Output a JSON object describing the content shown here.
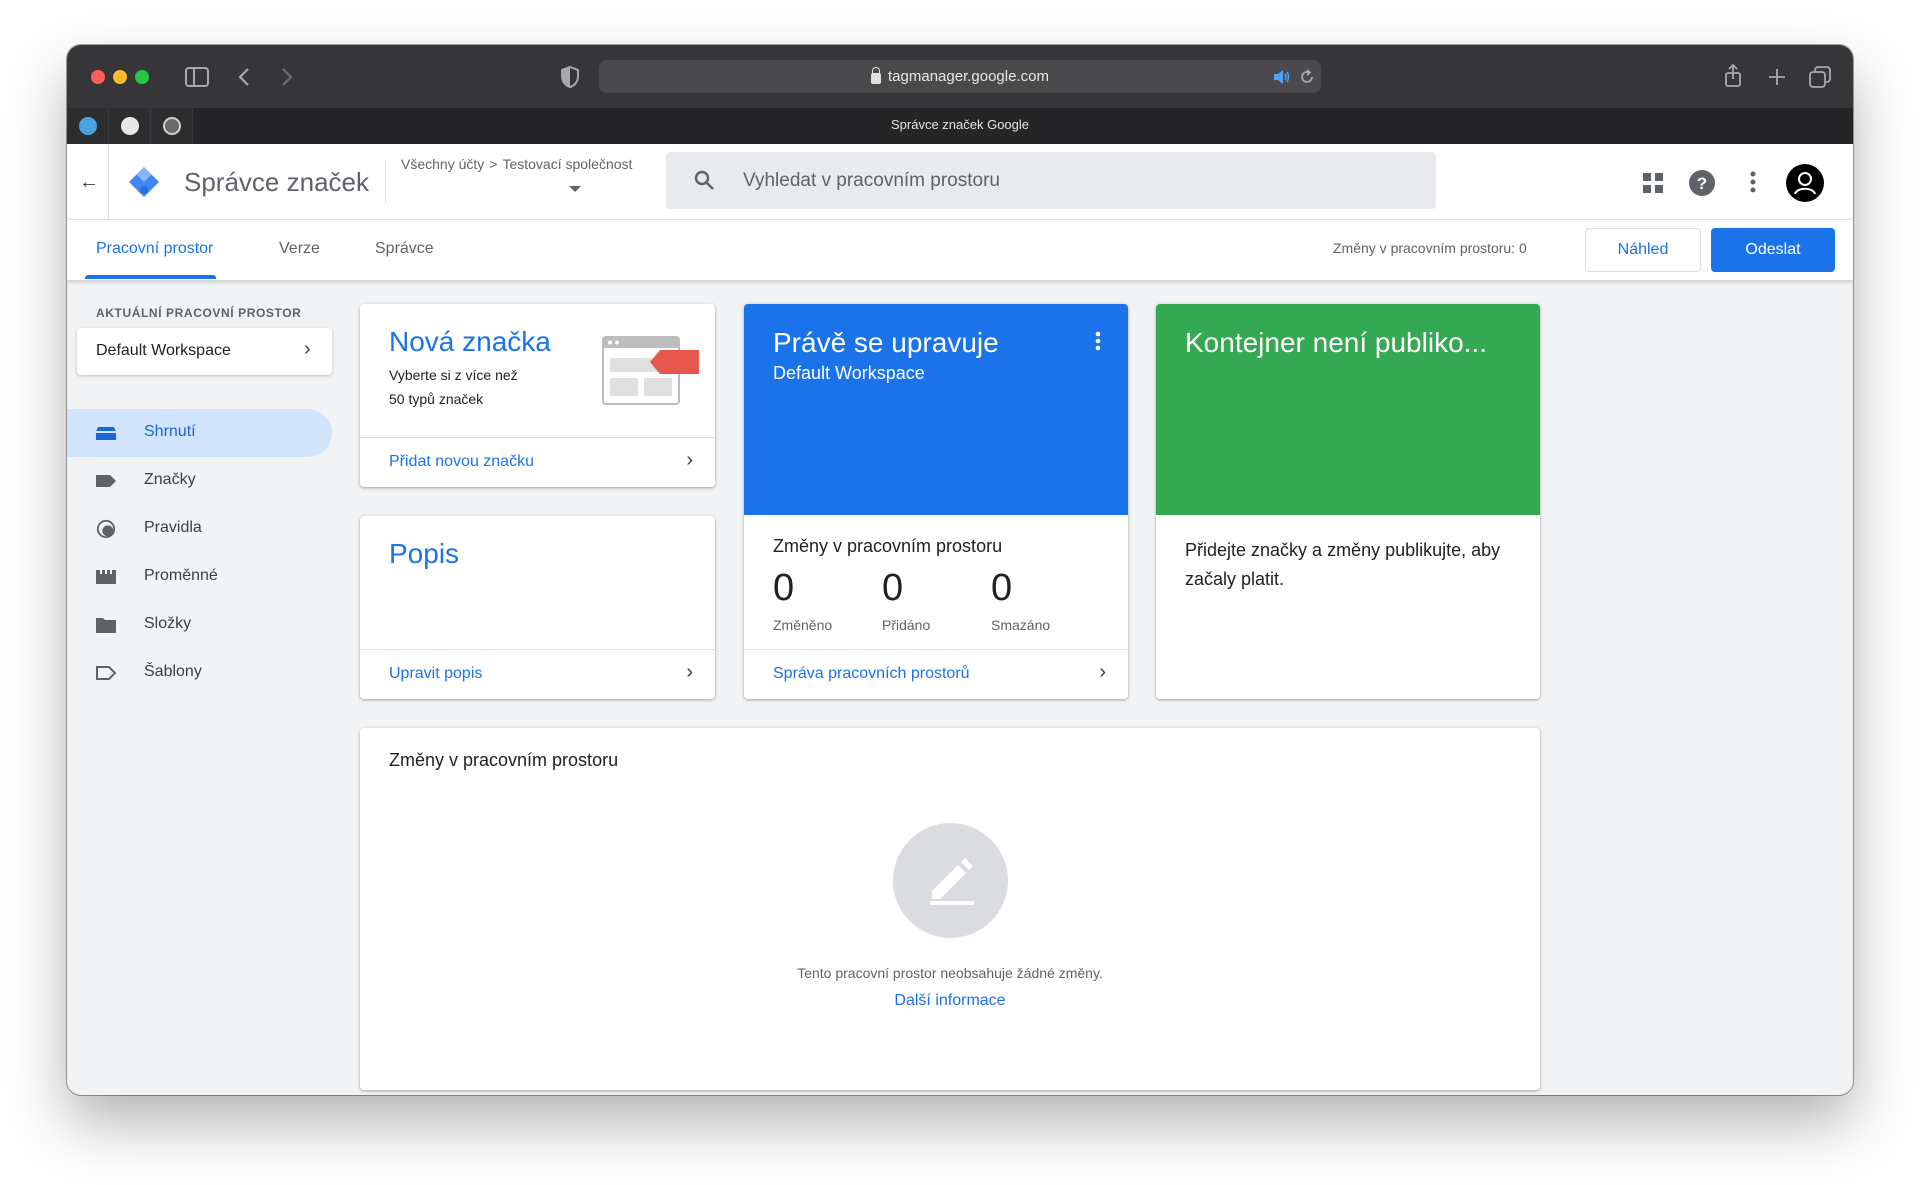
{
  "browser": {
    "url": "tagmanager.google.com",
    "tab_title": "Správce značek Google"
  },
  "header": {
    "app_name": "Správce značek",
    "breadcrumb": [
      "Všechny účty",
      ">",
      "Testovací společnost"
    ],
    "search_placeholder": "Vyhledat v pracovním prostoru"
  },
  "tabs": {
    "items": [
      {
        "label": "Pracovní prostor",
        "active": true
      },
      {
        "label": "Verze",
        "active": false
      },
      {
        "label": "Správce",
        "active": false
      }
    ],
    "changes_text": "Změny v pracovním prostoru: 0",
    "preview_label": "Náhled",
    "submit_label": "Odeslat"
  },
  "sidebar": {
    "workspace_heading": "AKTUÁLNÍ PRACOVNÍ PROSTOR",
    "workspace_name": "Default Workspace",
    "items": [
      {
        "label": "Shrnutí",
        "icon": "summary-icon",
        "active": true
      },
      {
        "label": "Značky",
        "icon": "tag-icon",
        "active": false
      },
      {
        "label": "Pravidla",
        "icon": "trigger-icon",
        "active": false
      },
      {
        "label": "Proměnné",
        "icon": "variables-icon",
        "active": false
      },
      {
        "label": "Složky",
        "icon": "folder-icon",
        "active": false
      },
      {
        "label": "Šablony",
        "icon": "template-icon",
        "active": false
      }
    ]
  },
  "cards": {
    "new_tag": {
      "title": "Nová značka",
      "subtitle_line1": "Vyberte si z více než",
      "subtitle_line2": "50 typů značek",
      "link": "Přidat novou značku"
    },
    "description": {
      "title": "Popis",
      "link": "Upravit popis"
    },
    "editing": {
      "title": "Právě se upravuje",
      "subtitle": "Default Workspace",
      "changes_heading": "Změny v pracovním prostoru",
      "counts": [
        {
          "value": "0",
          "label": "Změněno"
        },
        {
          "value": "0",
          "label": "Přidáno"
        },
        {
          "value": "0",
          "label": "Smazáno"
        }
      ],
      "link": "Správa pracovních prostorů"
    },
    "publish": {
      "title": "Kontejner není publiko...",
      "body": "Přidejte značky a změny publikujte, aby začaly platit."
    },
    "workspace_changes": {
      "title": "Změny v pracovním prostoru",
      "empty_text": "Tento pracovní prostor neobsahuje žádné změny.",
      "link": "Další informace"
    }
  },
  "colors": {
    "accent": "#1a73e8",
    "editing_card": "#1a73e8",
    "publish_card": "#34a853",
    "sidebar_active": "#d2e3fc"
  }
}
